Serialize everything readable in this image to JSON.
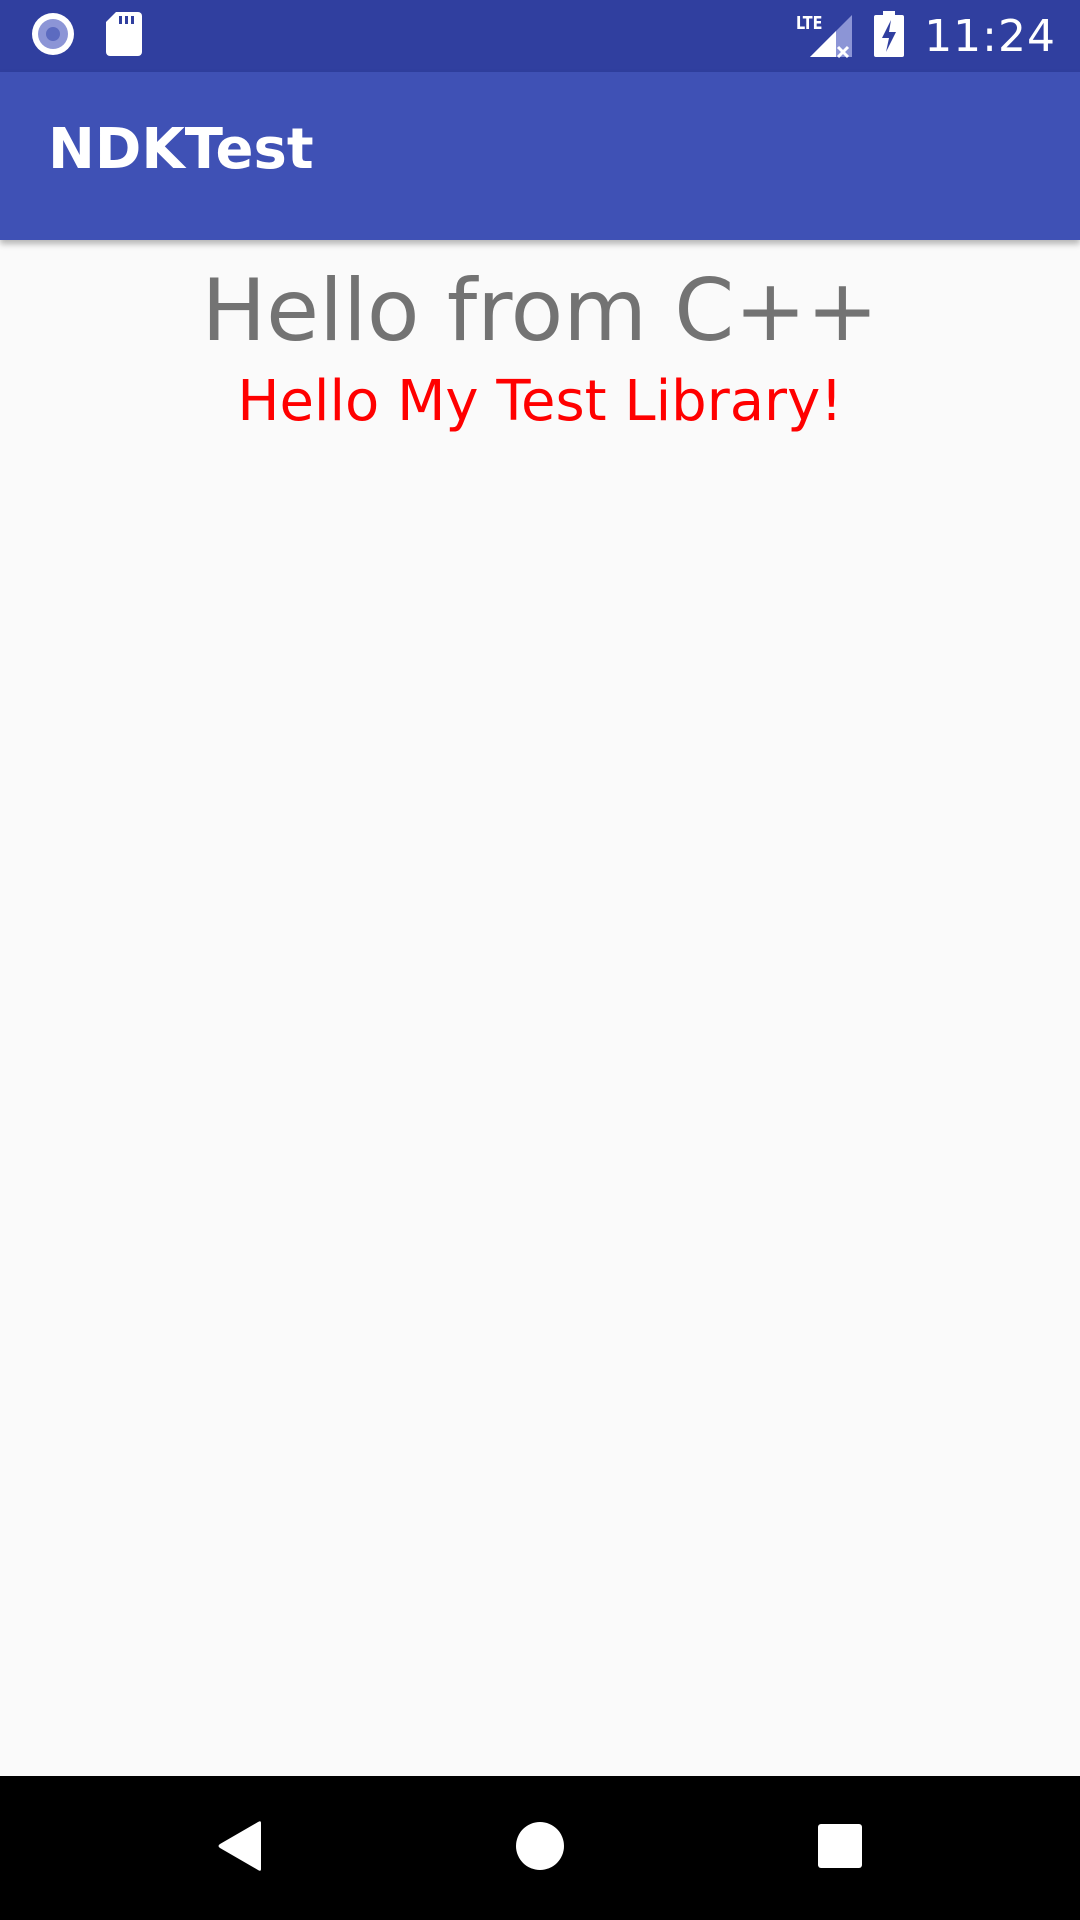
{
  "status_bar": {
    "time": "11:24",
    "network_label": "LTE",
    "icons": [
      "circle-notification-icon",
      "sd-card-icon",
      "lte-signal-icon",
      "battery-charging-icon"
    ],
    "background": "#303f9f"
  },
  "app_bar": {
    "title": "NDKTest",
    "background": "#3f51b5"
  },
  "content": {
    "primary_text": "Hello from C++",
    "primary_color": "#737373",
    "secondary_text": "Hello My Test Library!",
    "secondary_color": "#ff0000"
  },
  "nav_bar": {
    "buttons": [
      "back-icon",
      "home-icon",
      "recents-icon"
    ]
  }
}
